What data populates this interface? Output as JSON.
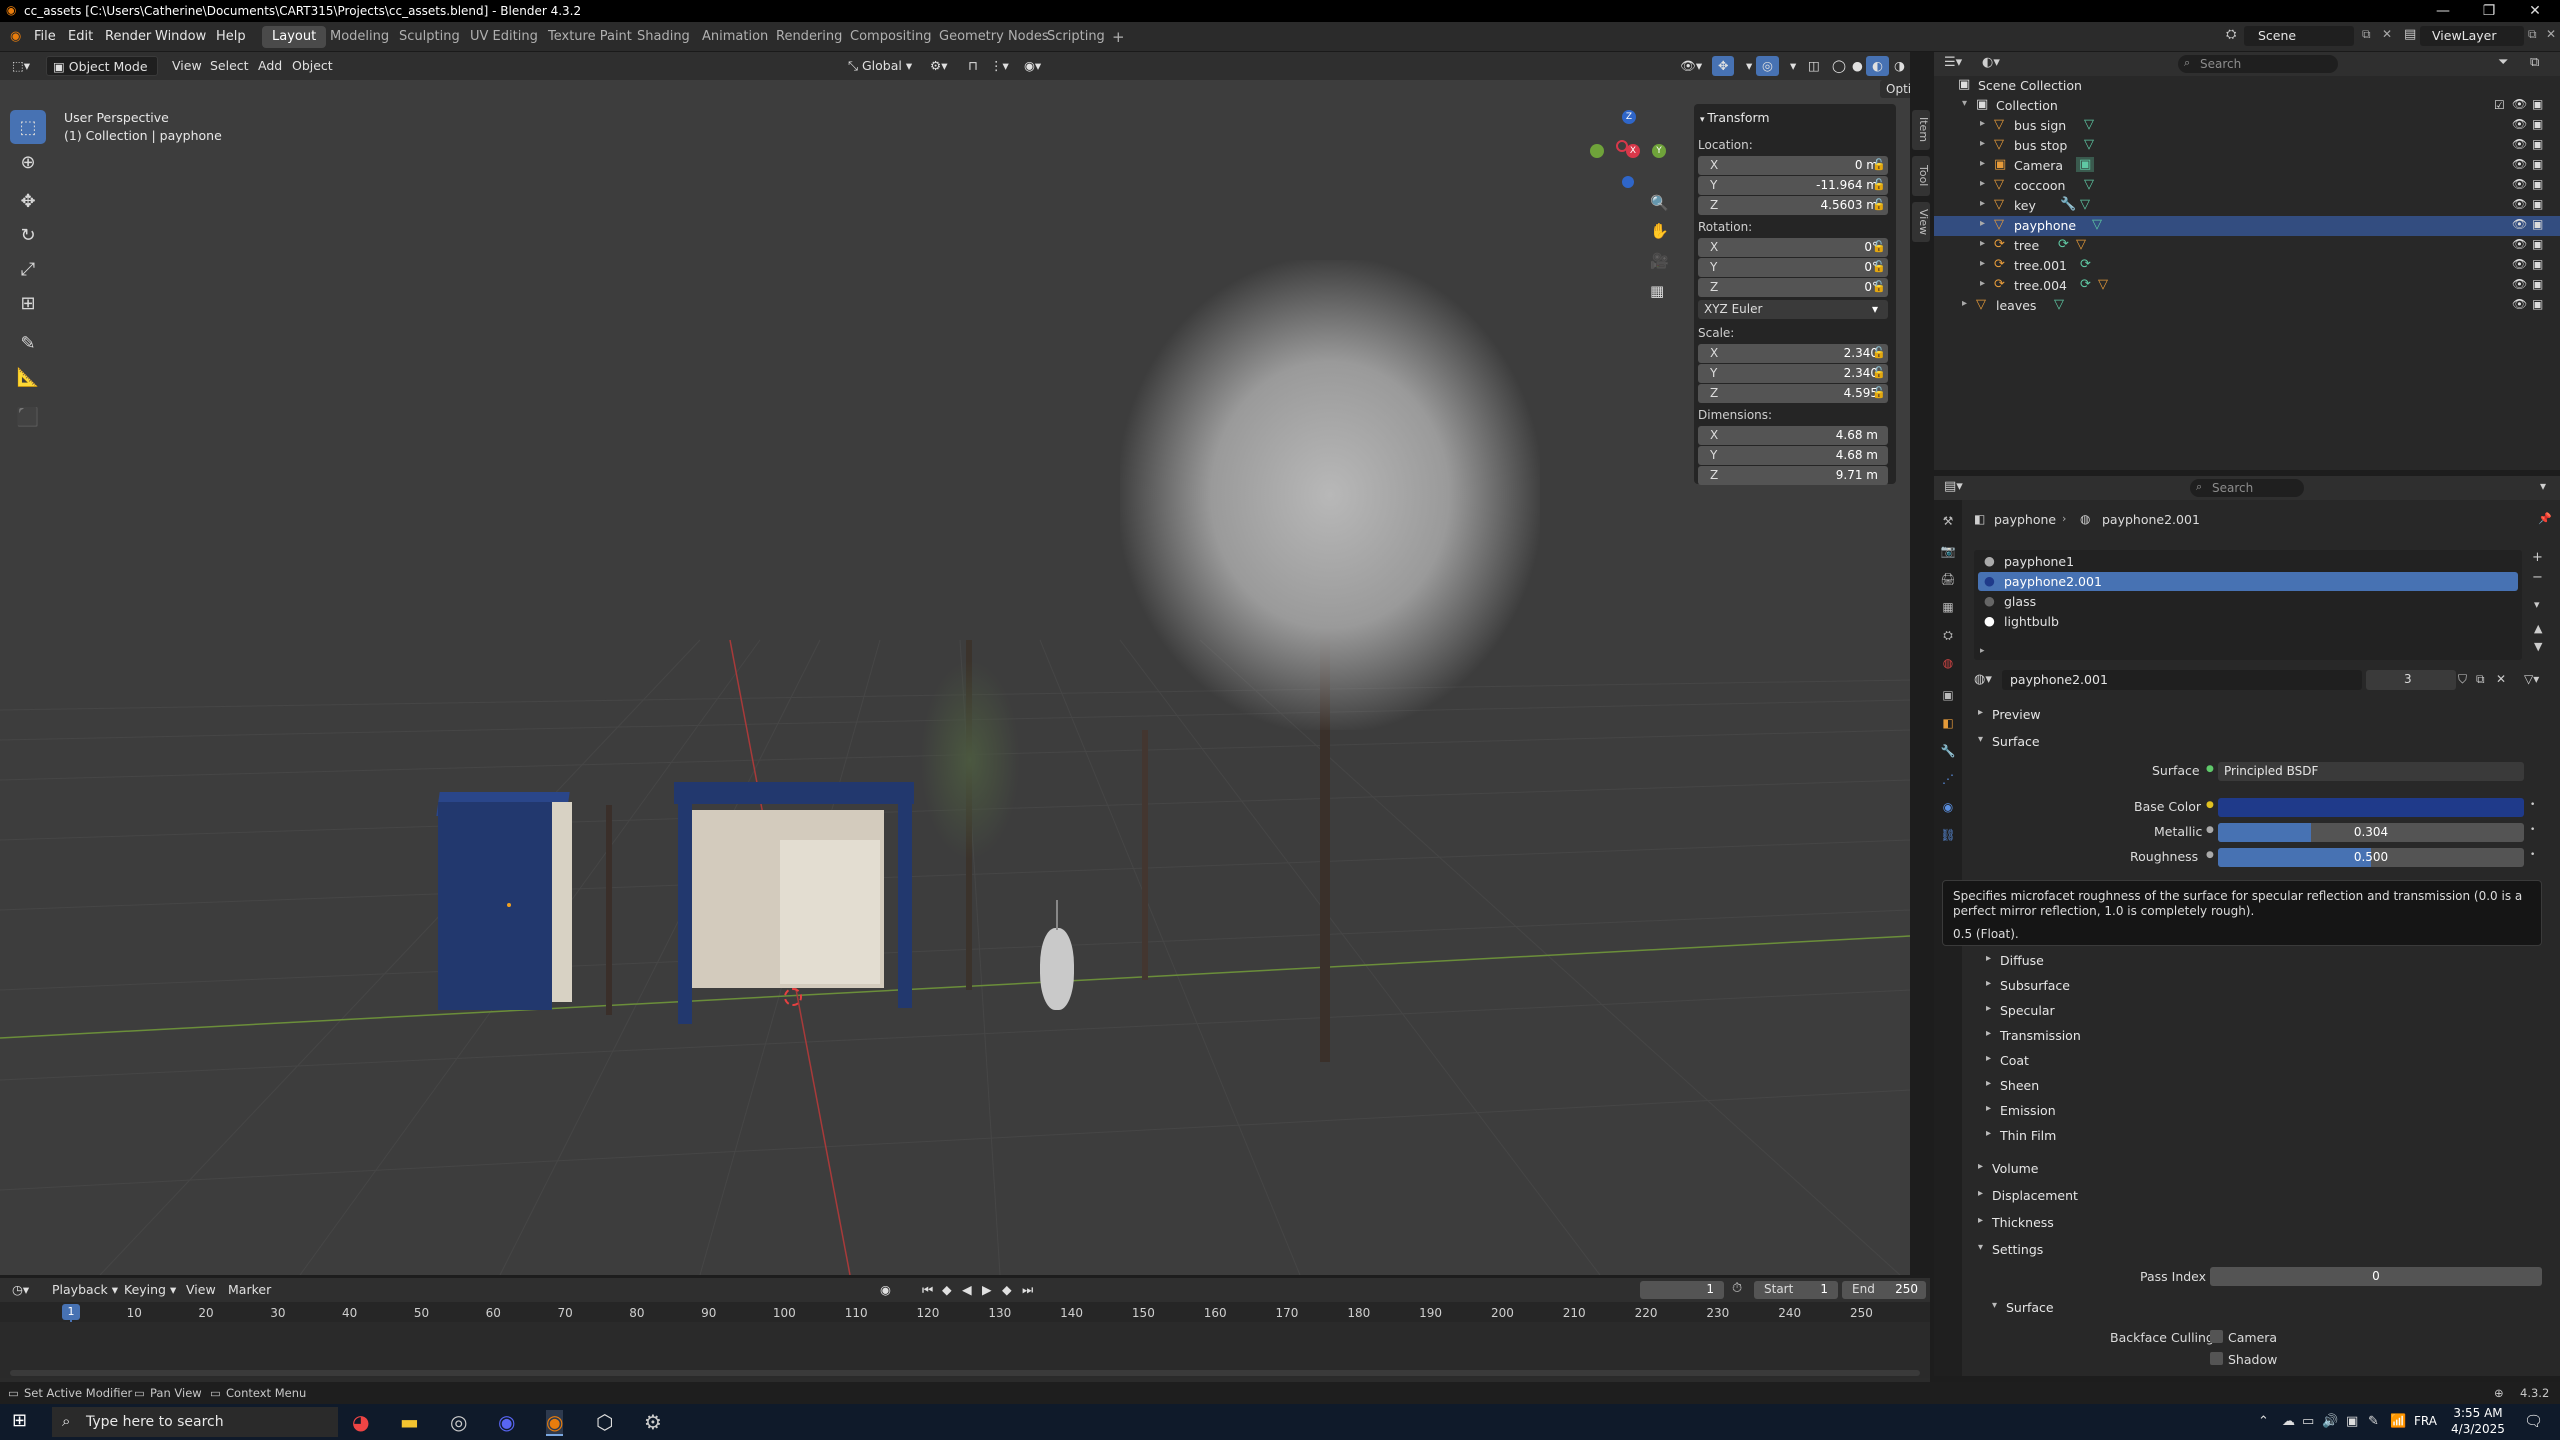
{
  "titlebar": {
    "title": "cc_assets [C:\\Users\\Catherine\\Documents\\CART315\\Projects\\cc_assets.blend] - Blender 4.3.2",
    "minimize": "—",
    "maximize": "❐",
    "close": "✕"
  },
  "menu": {
    "file": "File",
    "edit": "Edit",
    "render": "Render",
    "window": "Window",
    "help": "Help"
  },
  "workspaces": [
    "Layout",
    "Modeling",
    "Sculpting",
    "UV Editing",
    "Texture Paint",
    "Shading",
    "Animation",
    "Rendering",
    "Compositing",
    "Geometry Nodes",
    "Scripting"
  ],
  "workspace_add": "+",
  "scene": {
    "scene_label": "Scene",
    "viewlayer_label": "ViewLayer"
  },
  "viewport_header": {
    "mode": "Object Mode",
    "view": "View",
    "select": "Select",
    "add": "Add",
    "object": "Object",
    "transform_orientation": "Global",
    "options": "Options"
  },
  "viewport": {
    "perspective": "User Perspective",
    "collection_info": "(1) Collection | payphone",
    "gizmo": {
      "x": "X",
      "y": "Y",
      "z": "Z"
    }
  },
  "transform_panel": {
    "header": "Transform",
    "location_label": "Location:",
    "location": [
      {
        "axis": "X",
        "value": "0 m"
      },
      {
        "axis": "Y",
        "value": "-11.964 m"
      },
      {
        "axis": "Z",
        "value": "4.5603 m"
      }
    ],
    "rotation_label": "Rotation:",
    "rotation": [
      {
        "axis": "X",
        "value": "0°"
      },
      {
        "axis": "Y",
        "value": "0°"
      },
      {
        "axis": "Z",
        "value": "0°"
      }
    ],
    "rotation_mode": "XYZ Euler",
    "scale_label": "Scale:",
    "scale": [
      {
        "axis": "X",
        "value": "2.340"
      },
      {
        "axis": "Y",
        "value": "2.340"
      },
      {
        "axis": "Z",
        "value": "4.595"
      }
    ],
    "dimensions_label": "Dimensions:",
    "dimensions": [
      {
        "axis": "X",
        "value": "4.68 m"
      },
      {
        "axis": "Y",
        "value": "4.68 m"
      },
      {
        "axis": "Z",
        "value": "9.71 m"
      }
    ]
  },
  "side_tabs": [
    "Item",
    "Tool",
    "View"
  ],
  "outliner": {
    "search_placeholder": "Search",
    "scene_collection": "Scene Collection",
    "collection": "Collection",
    "items": [
      "bus sign",
      "bus stop",
      "Camera",
      "coccoon",
      "key",
      "payphone",
      "tree",
      "tree.001",
      "tree.004"
    ],
    "leaves": "leaves"
  },
  "properties": {
    "search_placeholder": "Search",
    "breadcrumb_object": "payphone",
    "breadcrumb_material": "payphone2.001",
    "slots": [
      "payphone1",
      "payphone2.001",
      "glass",
      "lightbulb"
    ],
    "active_slot": 1,
    "material_name": "payphone2.001",
    "user_count": "3",
    "sections": {
      "preview": "Preview",
      "surface": "Surface",
      "surface_label": "Surface",
      "surface_value": "Principled BSDF",
      "base_color_label": "Base Color",
      "metallic_label": "Metallic",
      "metallic_value": "0.304",
      "metallic_fraction": 0.304,
      "roughness_label": "Roughness",
      "roughness_value": "0.500",
      "roughness_fraction": 0.5,
      "base_color": "#1f3a8a",
      "subsections": [
        "Diffuse",
        "Subsurface",
        "Specular",
        "Transmission",
        "Coat",
        "Sheen",
        "Emission",
        "Thin Film"
      ],
      "volume": "Volume",
      "displacement": "Displacement",
      "thickness": "Thickness",
      "settings": "Settings",
      "pass_index_label": "Pass Index",
      "pass_index_value": "0",
      "surface_sub": "Surface",
      "backface_culling_label": "Backface Culling",
      "camera_label": "Camera",
      "shadow_label": "Shadow"
    }
  },
  "tooltip": {
    "text": "Specifies microfacet roughness of the surface for specular reflection and transmission (0.0 is a perfect mirror reflection, 1.0 is completely rough).",
    "value": "0.5 (Float)."
  },
  "timeline": {
    "playback": "Playback",
    "keying": "Keying",
    "view": "View",
    "marker": "Marker",
    "current_frame": "1",
    "start_label": "Start",
    "start": "1",
    "end_label": "End",
    "end": "250",
    "ticks": [
      "1",
      "10",
      "20",
      "30",
      "40",
      "50",
      "60",
      "70",
      "80",
      "90",
      "100",
      "110",
      "120",
      "130",
      "140",
      "150",
      "160",
      "170",
      "180",
      "190",
      "200",
      "210",
      "220",
      "230",
      "240",
      "250"
    ]
  },
  "statusbar": {
    "left1": "Set Active Modifier",
    "left2": "Pan View",
    "left3": "Context Menu",
    "version": "4.3.2"
  },
  "taskbar": {
    "search_placeholder": "Type here to search",
    "language": "FRA",
    "time": "3:55 AM",
    "date": "4/3/2025"
  },
  "colors": {
    "accent": "#4772b3",
    "viewport_bg": "#3d3d3d",
    "object_blue": "#22386e"
  }
}
